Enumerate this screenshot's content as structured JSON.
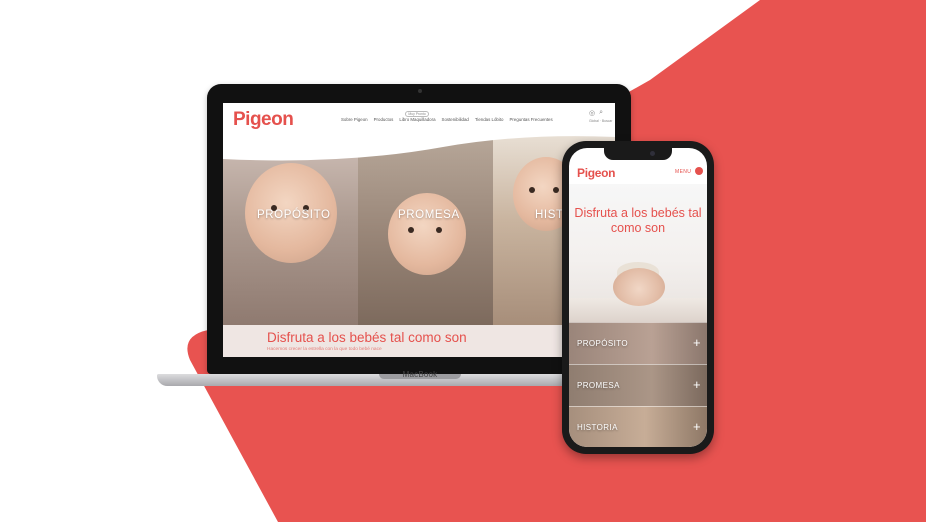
{
  "brand": {
    "accent": "#e5514d",
    "logo_text": "Pigeon"
  },
  "desktop": {
    "nav": {
      "items": [
        {
          "label": "Sobre Pigeon"
        },
        {
          "label": "Productos"
        },
        {
          "label": "Libro Maquilladora",
          "badge": "Muy Pronto"
        },
        {
          "label": "Sostenibilidad"
        },
        {
          "label": "Tiendas Lóbito"
        },
        {
          "label": "Preguntas Frecuentes"
        }
      ],
      "icons": [
        "globe-icon",
        "search-icon"
      ],
      "icon_labels": "Global · Buscar"
    },
    "panels": [
      {
        "label": "PROPÓSITO"
      },
      {
        "label": "PROMESA"
      },
      {
        "label": "HISTORIA"
      }
    ],
    "tagline": "Disfruta a los bebés tal como son",
    "subtagline": "Hacemos crecer la estrella con la que todo bebé nace"
  },
  "laptop_brand": "MacBook",
  "mobile": {
    "menu_label": "MENU",
    "tagline": "Disfruta a los bebés tal como son",
    "rows": [
      {
        "label": "PROPÓSITO"
      },
      {
        "label": "PROMESA"
      },
      {
        "label": "HISTORIA"
      }
    ]
  }
}
